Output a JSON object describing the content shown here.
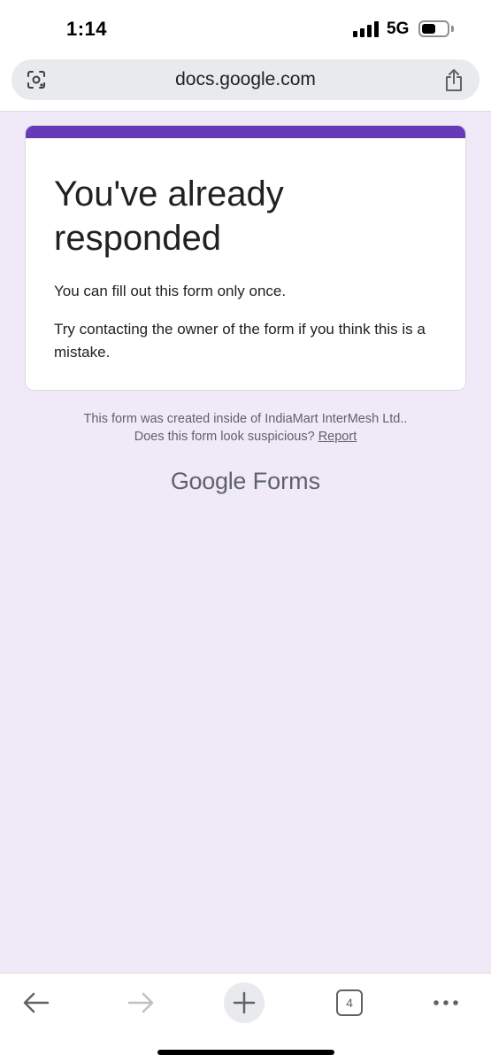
{
  "status_bar": {
    "time": "1:14",
    "network": "5G",
    "battery_level": 0.55
  },
  "browser": {
    "url": "docs.google.com",
    "icons": {
      "lens": "google-lens-icon",
      "share": "share-icon"
    }
  },
  "form": {
    "accent_color": "#673ab7",
    "background_color": "#efe9f8",
    "title": "You've already responded",
    "message": "You can fill out this form only once.",
    "hint": "Try contacting the owner of the form if you think this is a mistake."
  },
  "footer": {
    "created_inside": "This form was created inside of IndiaMart InterMesh Ltd..",
    "suspicious": "Does this form look suspicious?",
    "report": "Report"
  },
  "brand": {
    "google": "Google",
    "forms": "Forms"
  },
  "toolbar": {
    "tab_count": "4",
    "icons": [
      "back-icon",
      "forward-icon",
      "new-tab-icon",
      "tabs-icon",
      "more-icon"
    ]
  }
}
